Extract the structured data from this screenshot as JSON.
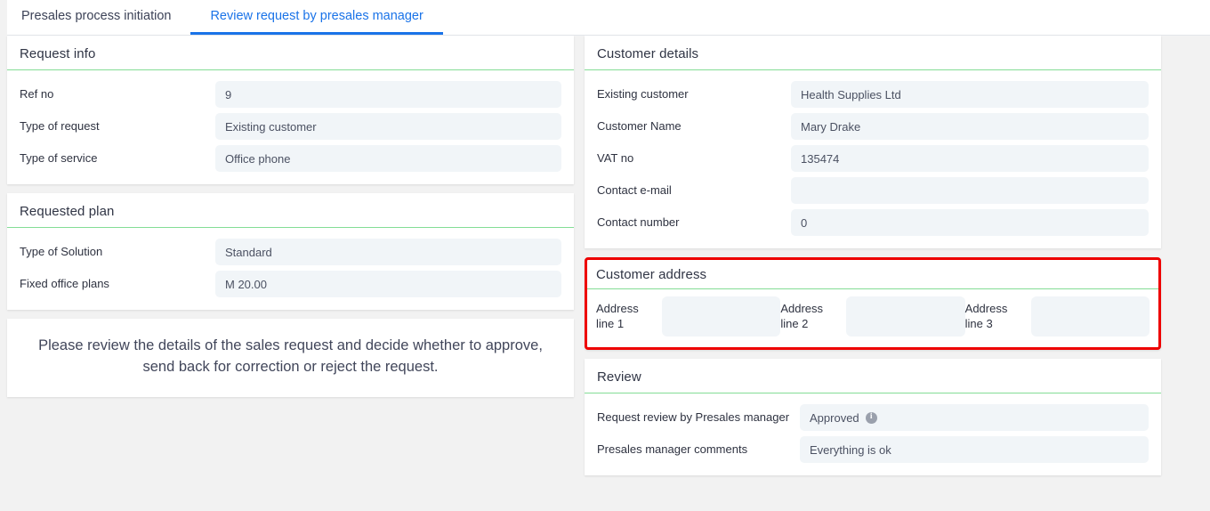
{
  "tabs": [
    {
      "label": "Presales process initiation",
      "active": false
    },
    {
      "label": "Review request by presales manager",
      "active": true
    }
  ],
  "colors": {
    "accent_blue": "#1a73e8",
    "divider_green": "#84dd95",
    "highlight_red": "#ee0000",
    "field_bg": "#f1f5f8",
    "page_bg": "#f2f2f2"
  },
  "request_info": {
    "title": "Request info",
    "fields": [
      {
        "label": "Ref no",
        "value": "9"
      },
      {
        "label": "Type of request",
        "value": "Existing customer"
      },
      {
        "label": "Type of service",
        "value": "Office phone"
      }
    ]
  },
  "requested_plan": {
    "title": "Requested plan",
    "fields": [
      {
        "label": "Type of Solution",
        "value": "Standard"
      },
      {
        "label": "Fixed office plans",
        "value": "M 20.00"
      }
    ]
  },
  "notice": {
    "text": "Please review the details of the sales request and decide whether to approve, send back for correction or reject the request."
  },
  "customer_details": {
    "title": "Customer details",
    "fields": [
      {
        "label": "Existing customer",
        "value": "Health Supplies Ltd"
      },
      {
        "label": "Customer Name",
        "value": "Mary Drake"
      },
      {
        "label": "VAT no",
        "value": "135474"
      },
      {
        "label": "Contact e-mail",
        "value": ""
      },
      {
        "label": "Contact number",
        "value": "0"
      }
    ]
  },
  "customer_address": {
    "title": "Customer address",
    "highlighted": true,
    "fields": [
      {
        "label": "Address line 1",
        "value": ""
      },
      {
        "label": "Address line 2",
        "value": ""
      },
      {
        "label": "Address line 3",
        "value": ""
      }
    ]
  },
  "review": {
    "title": "Review",
    "decision": {
      "label": "Request review by Presales manager",
      "value": "Approved",
      "info_icon": "info-icon"
    },
    "comments": {
      "label": "Presales manager comments",
      "value": "Everything is ok"
    }
  }
}
